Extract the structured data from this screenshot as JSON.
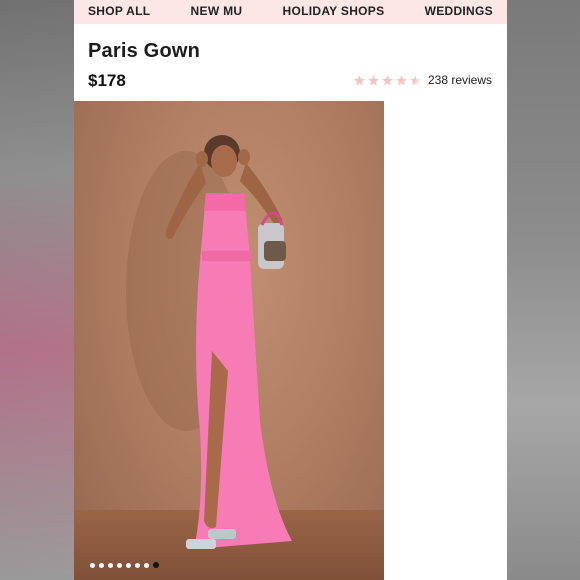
{
  "nav": {
    "items": [
      "SHOP ALL",
      "NEW MU",
      "HOLIDAY SHOPS",
      "WEDDINGS"
    ]
  },
  "product": {
    "title": "Paris Gown",
    "price": "$178",
    "rating": 4.5,
    "reviews_label": "238 reviews"
  },
  "gallery": {
    "image_count": 8,
    "active_index": 7
  },
  "colors": {
    "nav_bg": "#fde6e6",
    "star_fill": "#f3c4c4",
    "dress_pink": "#f77bb4"
  }
}
